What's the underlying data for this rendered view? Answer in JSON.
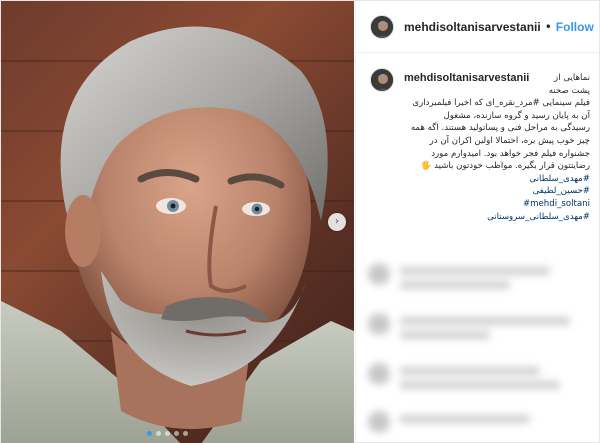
{
  "post": {
    "username": "mehdisoltanisarvestanii",
    "separator": "•",
    "follow_label": "Follow",
    "next_arrow": "›",
    "carousel": {
      "count": 5,
      "active_index": 0
    }
  },
  "caption": {
    "username": "mehdisoltanisarvestanii",
    "lines": [
      "نماهایی از",
      "پشت صحنه",
      "فیلم سینمایی #مرد_نقره_ای که اخیرا فیلمبرداری",
      "آن به پایان رسید و گروه سازنده، مشغول",
      "رسیدگی به مراحل فنی و پساتولید هستند. اگه همه",
      "چیز خوب پیش بره، احتمالا اولین اکران آن در",
      "جشنواره فیلم فجر خواهد بود. امیدوارم مورد",
      "رضایتتون قرار بگیره. مواظب خودتون باشید 🖐"
    ],
    "hashtags": [
      "#مهدی_سلطانی",
      "#حسین_لطیفی",
      "#mehdi_soltani",
      "#مهدی_سلطانی_سروستانی"
    ]
  },
  "icons": {
    "avatar": "profile-photo",
    "next": "chevron-right-icon"
  },
  "colors": {
    "follow": "#3897f0",
    "hashtag": "#003569",
    "text": "#262626"
  }
}
